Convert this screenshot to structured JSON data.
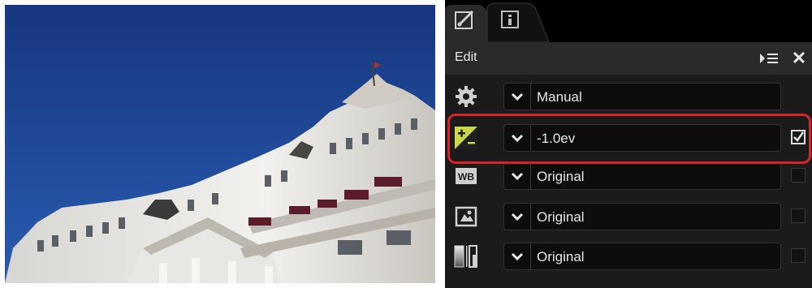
{
  "colors": {
    "sky": "#1a3d8a",
    "highlight": "#d8232a",
    "panel_bg": "#1b1b1b",
    "accent_exposure_icon": "#c9d74a"
  },
  "photo": {
    "subject_icon": "photo-hotel-facade"
  },
  "panel": {
    "tabs": [
      {
        "icon": "edit-brush-icon",
        "active": true
      },
      {
        "icon": "info-icon",
        "active": false
      }
    ],
    "header": {
      "title": "Edit",
      "menu_icon": "panel-menu-icon",
      "close_glyph": "✕"
    },
    "rows": [
      {
        "icon": "gear-icon",
        "value": "Manual",
        "has_checkbox": false,
        "checked": false
      },
      {
        "icon": "exposure-compensation-icon",
        "value": "-1.0ev",
        "has_checkbox": true,
        "checked": true
      },
      {
        "icon": "white-balance-icon",
        "icon_text": "WB",
        "value": "Original",
        "has_checkbox": true,
        "checked": false
      },
      {
        "icon": "picture-control-icon",
        "value": "Original",
        "has_checkbox": true,
        "checked": false
      },
      {
        "icon": "active-d-lighting-icon",
        "value": "Original",
        "has_checkbox": true,
        "checked": false
      }
    ]
  }
}
